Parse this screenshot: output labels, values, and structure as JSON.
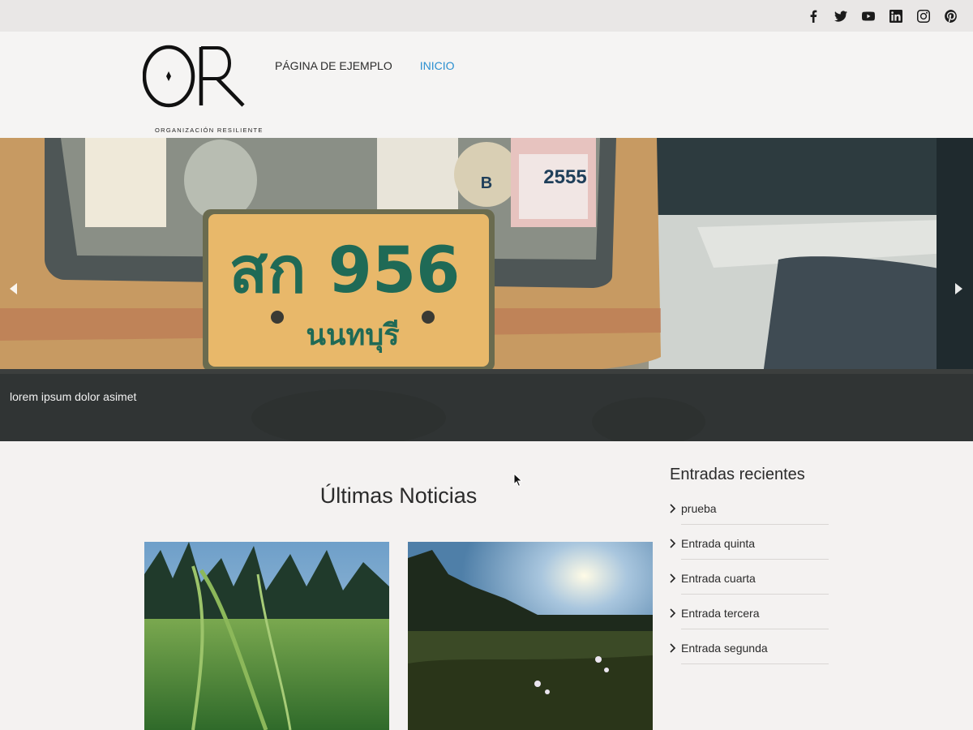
{
  "social": {
    "icons": [
      "facebook-icon",
      "twitter-icon",
      "youtube-icon",
      "linkedin-icon",
      "instagram-icon",
      "pinterest-icon"
    ]
  },
  "header": {
    "logo_text": "OR",
    "logo_tagline": "ORGANIZACIÓN RESILIENTE",
    "nav": [
      {
        "label": "PÁGINA DE EJEMPLO",
        "active": false
      },
      {
        "label": "INICIO",
        "active": true
      }
    ],
    "active_color": "#2a8fd0"
  },
  "slider": {
    "caption": "lorem ipsum dolor asimet",
    "plate_text": "สก 956",
    "plate_subtext": "นนทบุรี",
    "sticker_number": "2555",
    "sticker_letter": "B"
  },
  "main": {
    "news_title": "Últimas Noticias"
  },
  "sidebar": {
    "title": "Entradas recientes",
    "items": [
      "prueba",
      "Entrada quinta",
      "Entrada cuarta",
      "Entrada tercera",
      "Entrada segunda"
    ]
  },
  "colors": {
    "background": "#f4f2f1",
    "topbar": "#e9e7e6",
    "caption_bg": "#2d3030"
  }
}
